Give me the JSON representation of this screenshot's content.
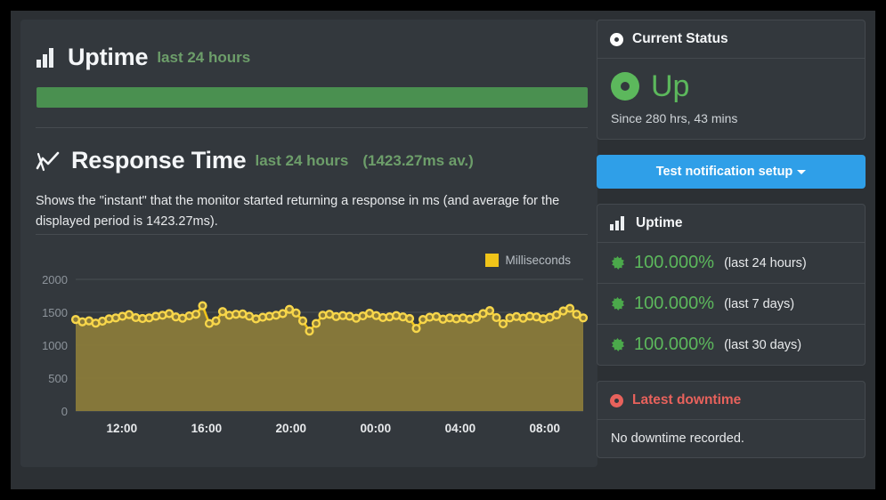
{
  "uptime_section": {
    "icon": "bar-chart-icon",
    "title": "Uptime",
    "subtitle": "last 24 hours",
    "bar_color": "#4a9050"
  },
  "response_section": {
    "icon": "line-chart-icon",
    "title": "Response Time",
    "subtitle": "last 24 hours",
    "average_label": "(1423.27ms av.)",
    "description": "Shows the \"instant\" that the monitor started returning a response in ms (and average for the displayed period is 1423.27ms)."
  },
  "chart_data": {
    "type": "area",
    "title": "Response Time",
    "xlabel": "",
    "ylabel": "",
    "ylim": [
      0,
      2000
    ],
    "yticks": [
      0,
      500,
      1000,
      1500,
      2000
    ],
    "ytick_labels": [
      "0",
      "500",
      "1000",
      "1500",
      "2000"
    ],
    "xtick_labels": [
      "12:00",
      "16:00",
      "20:00",
      "00:00",
      "04:00",
      "08:00"
    ],
    "xtick_positions": [
      0.0909,
      0.2576,
      0.4242,
      0.5909,
      0.7576,
      0.9242
    ],
    "grid": true,
    "legend": {
      "position": "top-right",
      "entries": [
        "Milliseconds"
      ]
    },
    "line_color": "#f0c419",
    "fill_color": "#8a7a3a",
    "marker_color": "#f7d64a",
    "series": [
      {
        "name": "Milliseconds",
        "values": [
          1390,
          1355,
          1370,
          1335,
          1365,
          1400,
          1415,
          1440,
          1465,
          1420,
          1405,
          1415,
          1440,
          1455,
          1480,
          1430,
          1410,
          1445,
          1470,
          1600,
          1330,
          1370,
          1510,
          1455,
          1470,
          1475,
          1440,
          1400,
          1425,
          1440,
          1455,
          1480,
          1545,
          1490,
          1370,
          1215,
          1330,
          1455,
          1470,
          1435,
          1450,
          1440,
          1410,
          1445,
          1485,
          1450,
          1420,
          1430,
          1450,
          1430,
          1405,
          1255,
          1390,
          1425,
          1435,
          1395,
          1415,
          1400,
          1415,
          1395,
          1420,
          1480,
          1525,
          1420,
          1325,
          1415,
          1435,
          1410,
          1440,
          1430,
          1400,
          1425,
          1460,
          1520,
          1560,
          1470,
          1415
        ]
      }
    ]
  },
  "current_status": {
    "header_icon": "record-dot-icon",
    "header": "Current Status",
    "status_icon": "status-dot-icon",
    "status": "Up",
    "since": "Since 280 hrs, 43 mins",
    "color": "#5cb85c"
  },
  "test_button": {
    "label": "Test notification setup",
    "icon": "caret-down-icon",
    "color": "#2f9fe8"
  },
  "uptime_card": {
    "header_icon": "bar-chart-icon",
    "header": "Uptime",
    "rows": [
      {
        "icon": "burst-icon",
        "percent": "100.000%",
        "period": "(last 24 hours)"
      },
      {
        "icon": "burst-icon",
        "percent": "100.000%",
        "period": "(last 7 days)"
      },
      {
        "icon": "burst-icon",
        "percent": "100.000%",
        "period": "(last 30 days)"
      }
    ]
  },
  "latest_downtime": {
    "header_icon": "record-dot-icon",
    "header": "Latest downtime",
    "message": "No downtime recorded.",
    "color": "#e8625c"
  }
}
